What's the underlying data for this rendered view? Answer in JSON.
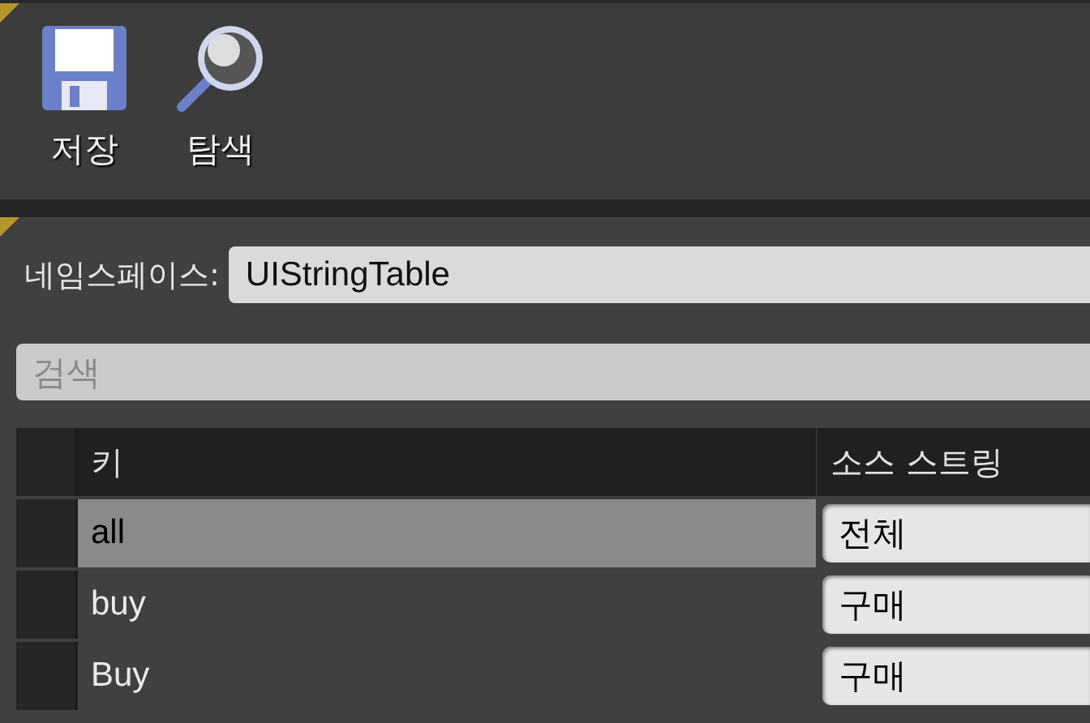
{
  "toolbar": {
    "buttons": [
      {
        "kind": "save",
        "label": "저장"
      },
      {
        "kind": "browse",
        "label": "탐색"
      }
    ]
  },
  "namespace": {
    "label": "네임스페이스:",
    "value": "UIStringTable"
  },
  "search": {
    "placeholder": "검색"
  },
  "table": {
    "columns": [
      "키",
      "소스 스트링"
    ],
    "rows": [
      {
        "key": "all",
        "source": "전체",
        "selected": true
      },
      {
        "key": "buy",
        "source": "구매",
        "selected": false
      },
      {
        "key": "Buy",
        "source": "구매",
        "selected": false
      }
    ]
  }
}
